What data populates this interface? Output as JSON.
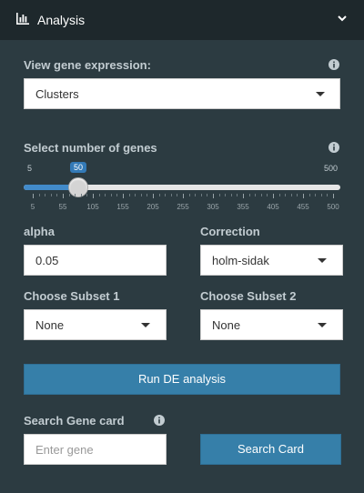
{
  "header": {
    "title": "Analysis",
    "icon": "bar-chart-icon",
    "chevron": "chevron-down-icon"
  },
  "view_expression": {
    "label": "View gene expression:",
    "selected": "Clusters"
  },
  "num_genes": {
    "label": "Select number of genes",
    "min_label": "5",
    "max_label": "500",
    "value_label": "50",
    "value": 50,
    "min": 5,
    "max": 500,
    "ticks": [
      "5",
      "55",
      "105",
      "155",
      "205",
      "255",
      "305",
      "355",
      "405",
      "455",
      "500"
    ]
  },
  "alpha": {
    "label": "alpha",
    "value": "0.05"
  },
  "correction": {
    "label": "Correction",
    "selected": "holm-sidak"
  },
  "subset1": {
    "label": "Choose Subset 1",
    "selected": "None"
  },
  "subset2": {
    "label": "Choose Subset 2",
    "selected": "None"
  },
  "run_button": {
    "label": "Run DE analysis"
  },
  "gene_card": {
    "label": "Search Gene card",
    "placeholder": "Enter gene",
    "button": "Search Card"
  },
  "colors": {
    "sidebar_bg": "#2c3b41",
    "header_bg": "#1e282c",
    "button_bg": "#367fa9",
    "slider_fill": "#428bca"
  }
}
